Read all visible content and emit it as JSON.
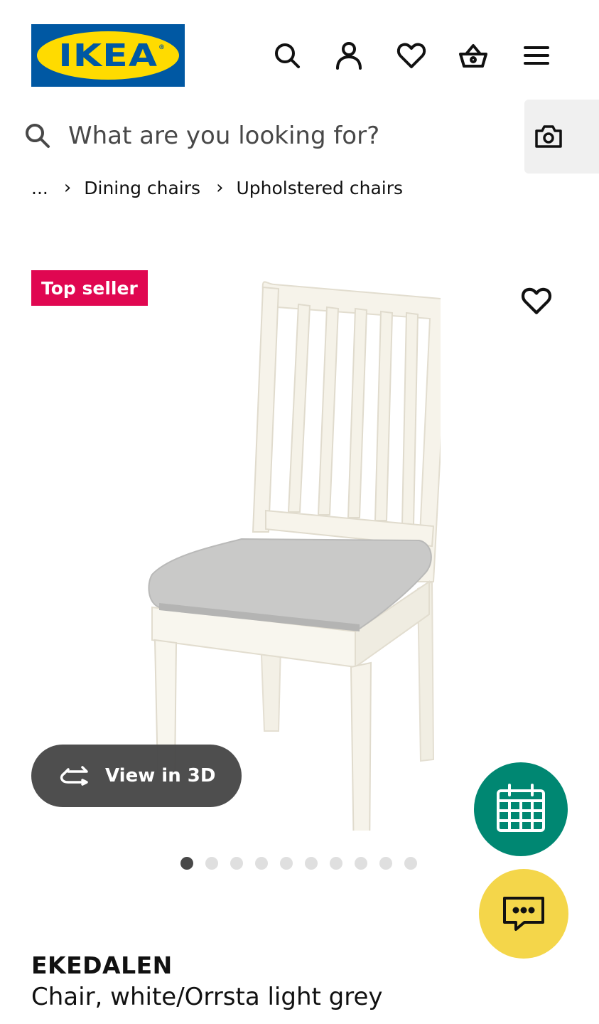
{
  "header": {
    "logo_text": "IKEA",
    "logo_registered": "®",
    "brand_blue": "#0058a3",
    "brand_yellow": "#ffdb00",
    "icons": [
      "search-icon",
      "account-icon",
      "heart-icon",
      "basket-icon",
      "menu-icon"
    ]
  },
  "search": {
    "placeholder": "What are you looking for?",
    "value": "",
    "visual_search_icon": "camera-icon"
  },
  "breadcrumb": {
    "items": [
      "...",
      "Dining chairs",
      "Upholstered chairs"
    ],
    "separator": "›"
  },
  "product_gallery": {
    "badge": "Top seller",
    "badge_color": "#e00751",
    "view_3d_label": "View in 3D",
    "image_count": 10,
    "active_image_index": 0
  },
  "floating_actions": {
    "calendar_icon": "calendar-icon",
    "calendar_color": "#008772",
    "chat_icon": "chat-icon",
    "chat_color": "#f4d64a"
  },
  "product": {
    "name": "EKEDALEN",
    "description": "Chair, white/Orrsta light grey"
  }
}
